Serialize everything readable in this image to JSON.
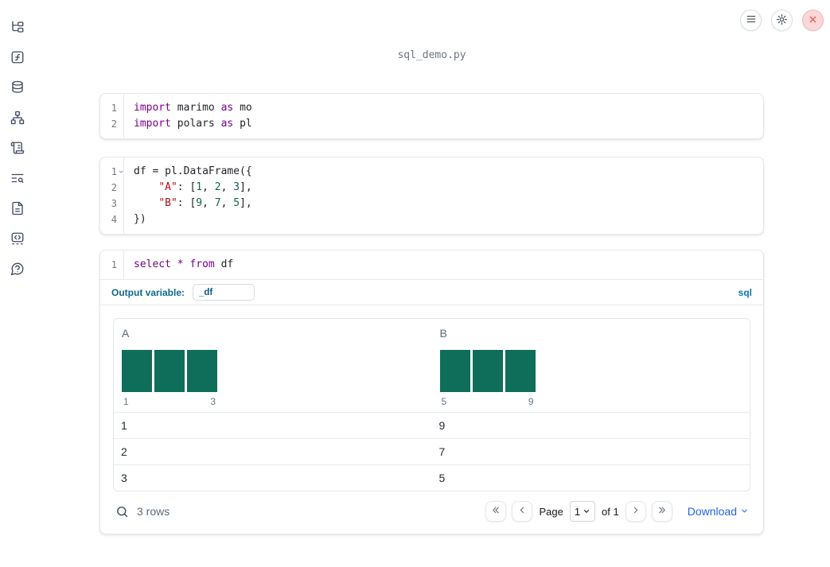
{
  "header": {
    "title": "sql_demo.py",
    "buttons": [
      {
        "name": "menu",
        "icon": "hamburger-icon"
      },
      {
        "name": "settings",
        "icon": "gear-icon"
      },
      {
        "name": "shutdown",
        "icon": "close-x-icon"
      }
    ]
  },
  "sidebar": {
    "items": [
      {
        "icon": "file-tree-icon"
      },
      {
        "icon": "function-square-icon"
      },
      {
        "icon": "database-icon"
      },
      {
        "icon": "dependency-graph-icon"
      },
      {
        "icon": "scroll-logs-icon"
      },
      {
        "icon": "text-search-icon"
      },
      {
        "icon": "document-icon"
      },
      {
        "icon": "code-snippets-icon"
      },
      {
        "icon": "help-bubble-icon"
      }
    ]
  },
  "code_cells": {
    "imports": {
      "lines": [
        {
          "no": "1",
          "tokens": [
            {
              "t": "import",
              "c": "k"
            },
            {
              "t": " marimo ",
              "c": "p"
            },
            {
              "t": "as",
              "c": "k"
            },
            {
              "t": " mo",
              "c": "p"
            }
          ]
        },
        {
          "no": "2",
          "tokens": [
            {
              "t": "import",
              "c": "k"
            },
            {
              "t": " polars ",
              "c": "p"
            },
            {
              "t": "as",
              "c": "k"
            },
            {
              "t": " pl",
              "c": "p"
            }
          ]
        }
      ]
    },
    "dataframe": {
      "lines": [
        {
          "no": "1",
          "fold": true,
          "tokens": [
            {
              "t": "df = pl.DataFrame({",
              "c": "p"
            }
          ]
        },
        {
          "no": "2",
          "tokens": [
            {
              "t": "    ",
              "c": "p"
            },
            {
              "t": "\"A\"",
              "c": "s"
            },
            {
              "t": ": [",
              "c": "p"
            },
            {
              "t": "1",
              "c": "n"
            },
            {
              "t": ", ",
              "c": "p"
            },
            {
              "t": "2",
              "c": "n"
            },
            {
              "t": ", ",
              "c": "p"
            },
            {
              "t": "3",
              "c": "n"
            },
            {
              "t": "],",
              "c": "p"
            }
          ]
        },
        {
          "no": "3",
          "tokens": [
            {
              "t": "    ",
              "c": "p"
            },
            {
              "t": "\"B\"",
              "c": "s"
            },
            {
              "t": ": [",
              "c": "p"
            },
            {
              "t": "9",
              "c": "n"
            },
            {
              "t": ", ",
              "c": "p"
            },
            {
              "t": "7",
              "c": "n"
            },
            {
              "t": ", ",
              "c": "p"
            },
            {
              "t": "5",
              "c": "n"
            },
            {
              "t": "],",
              "c": "p"
            }
          ]
        },
        {
          "no": "4",
          "tokens": [
            {
              "t": "})",
              "c": "p"
            }
          ]
        }
      ]
    },
    "sql": {
      "lines": [
        {
          "no": "1",
          "tokens": [
            {
              "t": "select",
              "c": "k"
            },
            {
              "t": " ",
              "c": "p"
            },
            {
              "t": "*",
              "c": "k"
            },
            {
              "t": " ",
              "c": "p"
            },
            {
              "t": "from",
              "c": "k"
            },
            {
              "t": " df",
              "c": "p"
            }
          ]
        }
      ]
    }
  },
  "sql_cell": {
    "output_variable_label": "Output variable:",
    "output_variable_value": "_df",
    "language_badge": "sql"
  },
  "table": {
    "columns": [
      {
        "label": "A",
        "histogram": {
          "type": "bar",
          "values": [
            1,
            1,
            1
          ],
          "bins": [
            1,
            2,
            3
          ],
          "min_label": "1",
          "max_label": "3",
          "bar_color": "#0e6e5a"
        }
      },
      {
        "label": "B",
        "histogram": {
          "type": "bar",
          "values": [
            1,
            1,
            1
          ],
          "bins": [
            5,
            7,
            9
          ],
          "min_label": "5",
          "max_label": "9",
          "bar_color": "#0e6e5a"
        }
      }
    ],
    "rows": [
      [
        "1",
        "9"
      ],
      [
        "2",
        "7"
      ],
      [
        "3",
        "5"
      ]
    ],
    "footer": {
      "row_count": "3 rows",
      "page_label": "Page",
      "page_value": "1",
      "of_label": "of 1",
      "download_label": "Download"
    }
  },
  "icons": {
    "search": "magnifier",
    "first_page": "chevrons-left",
    "prev_page": "chevron-left",
    "next_page": "chevron-right",
    "last_page": "chevrons-right",
    "download_caret": "chevron-down"
  },
  "colors": {
    "keyword": "#770088",
    "string": "#aa1111",
    "number": "#116644",
    "histogram_bar": "#0e6e5a",
    "output_variable_label": "#0d6a8c",
    "language_badge": "#0e76ad",
    "download_link": "#2563eb",
    "close_button_bg": "#fbd7d7"
  }
}
